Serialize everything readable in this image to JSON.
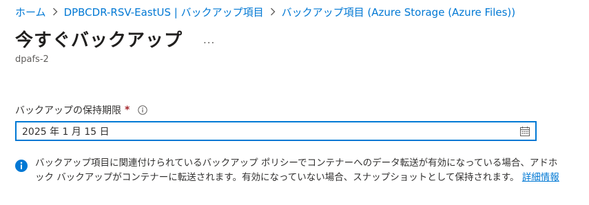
{
  "breadcrumb": {
    "home": "ホーム",
    "vault": "DPBCDR-RSV-EastUS | バックアップ項目",
    "items": "バックアップ項目 (Azure Storage (Azure Files))"
  },
  "header": {
    "title": "今すぐバックアップ",
    "more": "...",
    "subtitle": "dpafs-2"
  },
  "form": {
    "retention_label": "バックアップの保持期限",
    "required_marker": "*",
    "retention_value": "2025 年 1 月 15 日"
  },
  "notice": {
    "text": "バックアップ項目に関連付けられているバックアップ ポリシーでコンテナーへのデータ転送が有効になっている場合、アドホック バックアップがコンテナーに転送されます。有効になっていない場合、スナップショットとして保持されます。",
    "link": "詳細情報"
  },
  "colors": {
    "accent": "#0078d4",
    "required": "#a4262c",
    "text": "#323130",
    "secondary_text": "#605e5c"
  },
  "icons": [
    "chevron-right-icon",
    "more-icon",
    "info-tooltip-icon",
    "calendar-icon",
    "info-filled-icon"
  ]
}
